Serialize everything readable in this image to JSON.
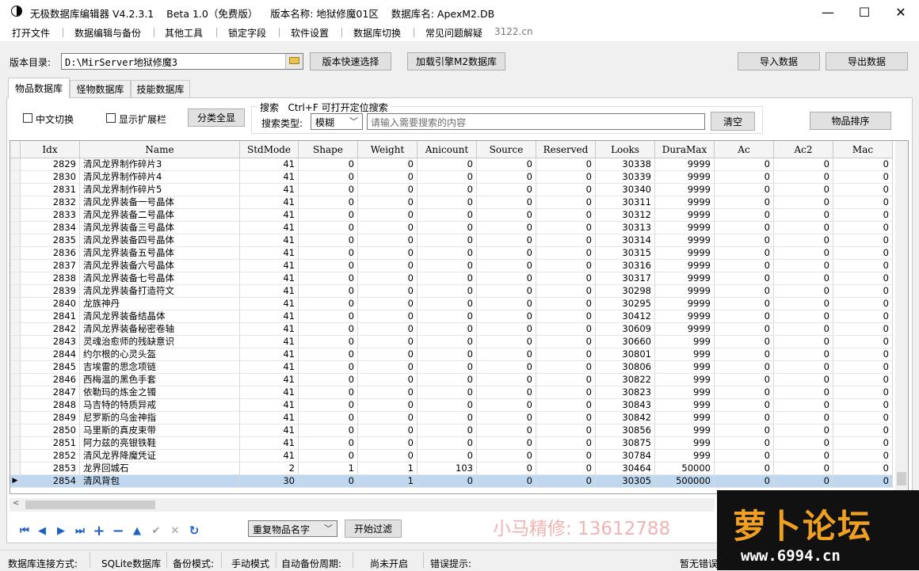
{
  "window": {
    "title": "无极数据库编辑器 V4.2.3.1    Beta 1.0（免费版）    版本名称: 地狱修魔01区    数据库名: ApexM2.DB",
    "minimize": "—",
    "maximize": "☐",
    "close": "✕"
  },
  "menu": [
    "打开文件",
    "数据编辑与备份",
    "其他工具",
    "锁定字段",
    "软件设置",
    "数据库切换",
    "常见问题解疑"
  ],
  "menu_url": "3122.cn",
  "toolbar": {
    "dir_label": "版本目录:",
    "dir_value": "D:\\MirServer地狱修魔3",
    "quick_select": "版本快速选择",
    "load_engine": "加载引擎M2数据库",
    "import": "导入数据",
    "export": "导出数据"
  },
  "tabs": [
    "物品数据库",
    "怪物数据库",
    "技能数据库"
  ],
  "filters": {
    "chinese_switch": "中文切换",
    "show_ext": "显示扩展栏",
    "show_all": "分类全显",
    "sort": "物品排序"
  },
  "search": {
    "legend": "搜索   Ctrl+F 可打开定位搜索",
    "type_label": "搜索类型:",
    "type_value": "模糊",
    "placeholder": "请输入需要搜索的内容",
    "clear": "清空"
  },
  "table": {
    "columns": [
      "Idx",
      "Name",
      "StdMode",
      "Shape",
      "Weight",
      "Anicount",
      "Source",
      "Reserved",
      "Looks",
      "DuraMax",
      "Ac",
      "Ac2",
      "Mac"
    ],
    "rows": [
      [
        "2829",
        "清风龙界制作碎片3",
        "41",
        "0",
        "0",
        "0",
        "0",
        "0",
        "30338",
        "9999",
        "0",
        "0",
        "0"
      ],
      [
        "2830",
        "清风龙界制作碎片4",
        "41",
        "0",
        "0",
        "0",
        "0",
        "0",
        "30339",
        "9999",
        "0",
        "0",
        "0"
      ],
      [
        "2831",
        "清风龙界制作碎片5",
        "41",
        "0",
        "0",
        "0",
        "0",
        "0",
        "30340",
        "9999",
        "0",
        "0",
        "0"
      ],
      [
        "2832",
        "清风龙界装备一号晶体",
        "41",
        "0",
        "0",
        "0",
        "0",
        "0",
        "30311",
        "9999",
        "0",
        "0",
        "0"
      ],
      [
        "2833",
        "清风龙界装备二号晶体",
        "41",
        "0",
        "0",
        "0",
        "0",
        "0",
        "30312",
        "9999",
        "0",
        "0",
        "0"
      ],
      [
        "2834",
        "清风龙界装备三号晶体",
        "41",
        "0",
        "0",
        "0",
        "0",
        "0",
        "30313",
        "9999",
        "0",
        "0",
        "0"
      ],
      [
        "2835",
        "清风龙界装备四号晶体",
        "41",
        "0",
        "0",
        "0",
        "0",
        "0",
        "30314",
        "9999",
        "0",
        "0",
        "0"
      ],
      [
        "2836",
        "清风龙界装备五号晶体",
        "41",
        "0",
        "0",
        "0",
        "0",
        "0",
        "30315",
        "9999",
        "0",
        "0",
        "0"
      ],
      [
        "2837",
        "清风龙界装备六号晶体",
        "41",
        "0",
        "0",
        "0",
        "0",
        "0",
        "30316",
        "9999",
        "0",
        "0",
        "0"
      ],
      [
        "2838",
        "清风龙界装备七号晶体",
        "41",
        "0",
        "0",
        "0",
        "0",
        "0",
        "30317",
        "9999",
        "0",
        "0",
        "0"
      ],
      [
        "2839",
        "清风龙界装备打造符文",
        "41",
        "0",
        "0",
        "0",
        "0",
        "0",
        "30298",
        "9999",
        "0",
        "0",
        "0"
      ],
      [
        "2840",
        "龙族神丹",
        "41",
        "0",
        "0",
        "0",
        "0",
        "0",
        "30295",
        "9999",
        "0",
        "0",
        "0"
      ],
      [
        "2841",
        "清风龙界装备结晶体",
        "41",
        "0",
        "0",
        "0",
        "0",
        "0",
        "30412",
        "9999",
        "0",
        "0",
        "0"
      ],
      [
        "2842",
        "清风龙界装备秘密卷轴",
        "41",
        "0",
        "0",
        "0",
        "0",
        "0",
        "30609",
        "9999",
        "0",
        "0",
        "0"
      ],
      [
        "2843",
        "灵魂治愈师的残缺意识",
        "41",
        "0",
        "0",
        "0",
        "0",
        "0",
        "30660",
        "999",
        "0",
        "0",
        "0"
      ],
      [
        "2844",
        "约尔根的心灵头盔",
        "41",
        "0",
        "0",
        "0",
        "0",
        "0",
        "30801",
        "999",
        "0",
        "0",
        "0"
      ],
      [
        "2845",
        "吉埃雷的思念项链",
        "41",
        "0",
        "0",
        "0",
        "0",
        "0",
        "30806",
        "999",
        "0",
        "0",
        "0"
      ],
      [
        "2846",
        "西梅温的黑色手套",
        "41",
        "0",
        "0",
        "0",
        "0",
        "0",
        "30822",
        "999",
        "0",
        "0",
        "0"
      ],
      [
        "2847",
        "依勒玛的炼金之镯",
        "41",
        "0",
        "0",
        "0",
        "0",
        "0",
        "30823",
        "999",
        "0",
        "0",
        "0"
      ],
      [
        "2848",
        "马吉特的特质异戒",
        "41",
        "0",
        "0",
        "0",
        "0",
        "0",
        "30843",
        "999",
        "0",
        "0",
        "0"
      ],
      [
        "2849",
        "尼罗斯的乌金神指",
        "41",
        "0",
        "0",
        "0",
        "0",
        "0",
        "30842",
        "999",
        "0",
        "0",
        "0"
      ],
      [
        "2850",
        "马里斯的真皮束带",
        "41",
        "0",
        "0",
        "0",
        "0",
        "0",
        "30856",
        "999",
        "0",
        "0",
        "0"
      ],
      [
        "2851",
        "阿力兹的亮银铁鞋",
        "41",
        "0",
        "0",
        "0",
        "0",
        "0",
        "30875",
        "999",
        "0",
        "0",
        "0"
      ],
      [
        "2852",
        "清风龙界降魔凭证",
        "41",
        "0",
        "0",
        "0",
        "0",
        "0",
        "30784",
        "999",
        "0",
        "0",
        "0"
      ],
      [
        "2853",
        "龙界回城石",
        "2",
        "1",
        "1",
        "103",
        "0",
        "0",
        "30464",
        "50000",
        "0",
        "0",
        "0"
      ],
      [
        "2854",
        "清风背包",
        "30",
        "0",
        "1",
        "0",
        "0",
        "0",
        "30305",
        "500000",
        "0",
        "0",
        "0"
      ]
    ],
    "selected_row_indicator": "▶"
  },
  "navigator": {
    "first": "⏮",
    "prev": "◀",
    "next": "▶",
    "last": "⏭",
    "add": "+",
    "delete": "−",
    "up": "▲",
    "post": "✔",
    "cancel": "✕",
    "refresh": "↻"
  },
  "dup_filter": {
    "value": "重复物品名字",
    "start": "开始过滤"
  },
  "watermark": {
    "text": "小马精修: 13612788",
    "logo": "萝卜论坛",
    "logo_url": "www.6994.cn"
  },
  "status": {
    "conn_label": "数据库连接方式:",
    "conn_value": "SQLite数据库",
    "backup_label": "备份模式:",
    "backup_value": "手动模式",
    "auto_label": "自动备份周期:",
    "auto_value": "尚未开启",
    "error_label": "错误提示:",
    "error_value": "暂无错误"
  },
  "colors": {
    "selected_row": "#c0d8ef",
    "nav_blue": "#1f5fc6",
    "watermark_pink": "#f1b3b3",
    "logo_orange": "#f0a020"
  }
}
